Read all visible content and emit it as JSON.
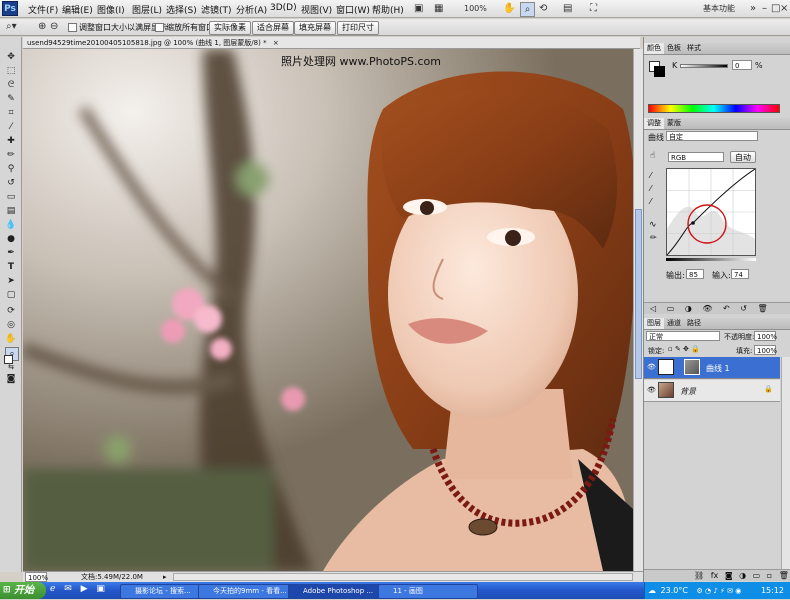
{
  "app": {
    "logo": "Ps",
    "menus": [
      "文件(F)",
      "编辑(E)",
      "图像(I)",
      "图层(L)",
      "选择(S)",
      "滤镜(T)",
      "分析(A)",
      "3D(D)",
      "视图(V)",
      "窗口(W)",
      "帮助(H)"
    ],
    "zoom_readout": "100%",
    "workspace": "基本功能"
  },
  "options_bar": {
    "resize_windows": "调整窗口大小以满屏显示",
    "zoom_all": "缩放所有窗口",
    "actual_pixels": "实际像素",
    "fit_screen": "适合屏幕",
    "fill_screen": "填充屏幕",
    "print_size": "打印尺寸"
  },
  "document": {
    "tab_title": "usend94529time20100405105818.jpg @ 100% (曲线 1, 图层蒙版/8) *",
    "watermark": "照片处理网  www.PhotoPS.com",
    "status_zoom": "100%",
    "status_doc": "文档:5.49M/22.0M"
  },
  "color_panel": {
    "tabs": [
      "颜色",
      "色板",
      "样式"
    ],
    "slider_label": "K",
    "value": "0",
    "unit": "%"
  },
  "adjustments_panel": {
    "tabs": [
      "调整",
      "蒙版"
    ],
    "title": "曲线",
    "preset": "自定",
    "channel": "RGB",
    "auto_label": "自动",
    "output_label": "输出:",
    "output_value": "85",
    "input_label": "输入:",
    "input_value": "74"
  },
  "layers_panel": {
    "tabs": [
      "图层",
      "通道",
      "路径"
    ],
    "blend_mode": "正常",
    "opacity_label": "不透明度:",
    "opacity": "100%",
    "lock_label": "锁定:",
    "fill_label": "填充:",
    "fill": "100%",
    "layers": [
      {
        "name": "曲线 1",
        "selected": true
      },
      {
        "name": "背景",
        "selected": false
      }
    ]
  },
  "taskbar": {
    "start": "开始",
    "tasks": [
      "摄影论坛 - 搜索...",
      "今天拍的9mm - 看看...",
      "Adobe Photoshop ...",
      "11 - 画图"
    ],
    "weather": "23.0°C",
    "clock": "15:12"
  },
  "colors": {
    "accent": "#2a6fd4",
    "taskbar": "#2457c9",
    "selected_layer": "#3b6fd1",
    "curve_circle": "#d01010"
  }
}
